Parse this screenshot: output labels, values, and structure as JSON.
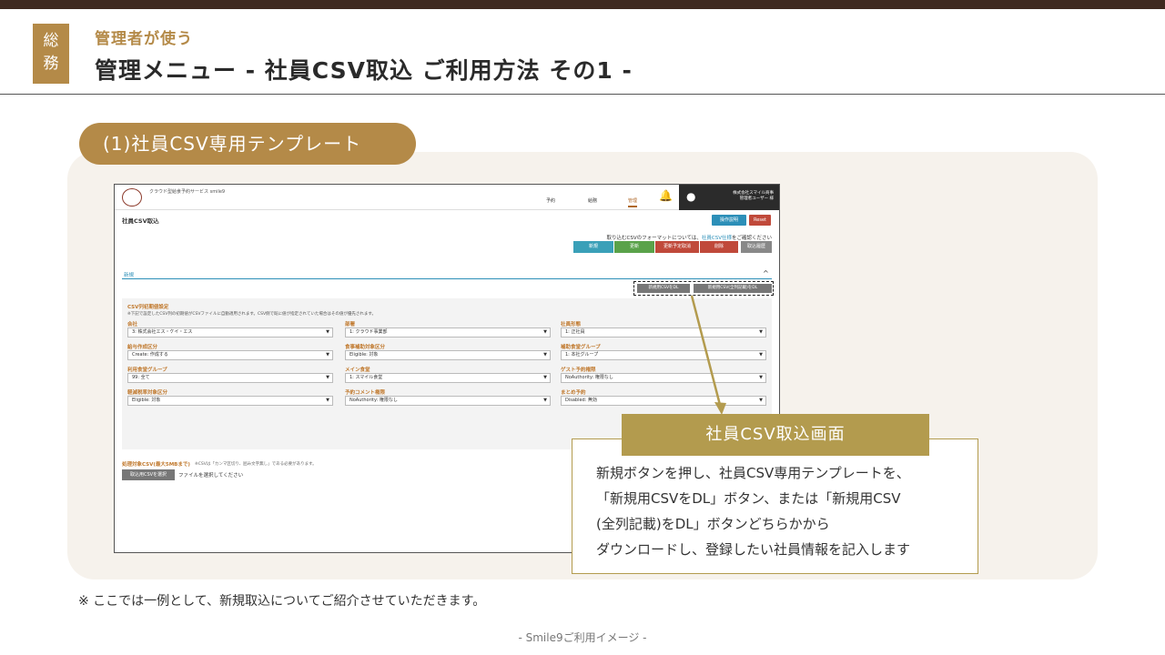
{
  "header": {
    "badge": [
      "総",
      "務"
    ],
    "subtitle": "管理者が使う",
    "title": "管理メニュー - 社員CSV取込 ご利用方法 その1 -"
  },
  "section": {
    "label": "(1)社員CSV専用テンプレート"
  },
  "screenshot": {
    "app_name": "クラウド型給食予約サービス smile9",
    "nav": [
      "予約",
      "給務",
      "管理"
    ],
    "active_nav": "管理",
    "company": "株式会社スマイル商事",
    "user": "管理者ユーザー 様",
    "page_title": "社員CSV取込",
    "help_button": "操作説明",
    "reset_button": "Reset",
    "format_note_prefix": "取り込むCSVのフォーマットについては、",
    "format_note_link": "社員CSV仕様",
    "format_note_suffix": "をご確認ください",
    "format_buttons": [
      {
        "label": "新規",
        "color": "#3aa0b8"
      },
      {
        "label": "更新",
        "color": "#5aa24a"
      },
      {
        "label": "更新予定取消",
        "color": "#c0493a"
      },
      {
        "label": "削除",
        "color": "#c0493a"
      },
      {
        "label": "取込履歴",
        "color": "#888888"
      }
    ],
    "tab_label": "新規",
    "dl_buttons": [
      "新規用CSVをDL",
      "新規用CSV(全列記載)をDL"
    ],
    "form_title": "CSV列初期値設定",
    "form_note": "※下記で設定したCSV列の初期値がCSVファイルに自動適用されます。CSV側で既に値が指定されていた場合はその値が優先されます。",
    "fields": [
      {
        "label": "会社",
        "value": "3: 株式会社エス・ケイ・エス"
      },
      {
        "label": "部署",
        "value": "1: クラウド事業部"
      },
      {
        "label": "社員形態",
        "value": "1: 正社員"
      },
      {
        "label": "給与作成区分",
        "value": "Create: 作成する"
      },
      {
        "label": "食事補助対象区分",
        "value": "Eligible: 対象"
      },
      {
        "label": "補助食堂グループ",
        "value": "1: 本社グループ"
      },
      {
        "label": "利用食堂グループ",
        "value": "99: 全て"
      },
      {
        "label": "メイン食堂",
        "value": "1: スマイル食堂"
      },
      {
        "label": "ゲスト予約権限",
        "value": "NoAuthority: 権限なし"
      },
      {
        "label": "軽減税率対象区分",
        "value": "Eligible: 対象"
      },
      {
        "label": "予約コメント権限",
        "value": "NoAuthority: 権限なし"
      },
      {
        "label": "まとめ予約",
        "value": "Disabled: 無効"
      }
    ],
    "target_label": "処理対象CSV(最大5MBまで)",
    "target_note": "※CSVは「カンマ区切り、囲み文字無し」である必要があります。",
    "choose_button": "取込用CSVを選択",
    "choose_text": "ファイルを選択してください"
  },
  "callout": {
    "title": "社員CSV取込画面",
    "lines": [
      "新規ボタンを押し、社員CSV専用テンプレートを、",
      "「新規用CSVをDL」ボタン、または「新規用CSV",
      "(全列記載)をDL」ボタンどちらかから",
      "ダウンロードし、登録したい社員情報を記入します"
    ]
  },
  "footnote": "※ ここでは一例として、新規取込についてご紹介させていただきます。",
  "footer": "- Smile9ご利用イメージ -"
}
